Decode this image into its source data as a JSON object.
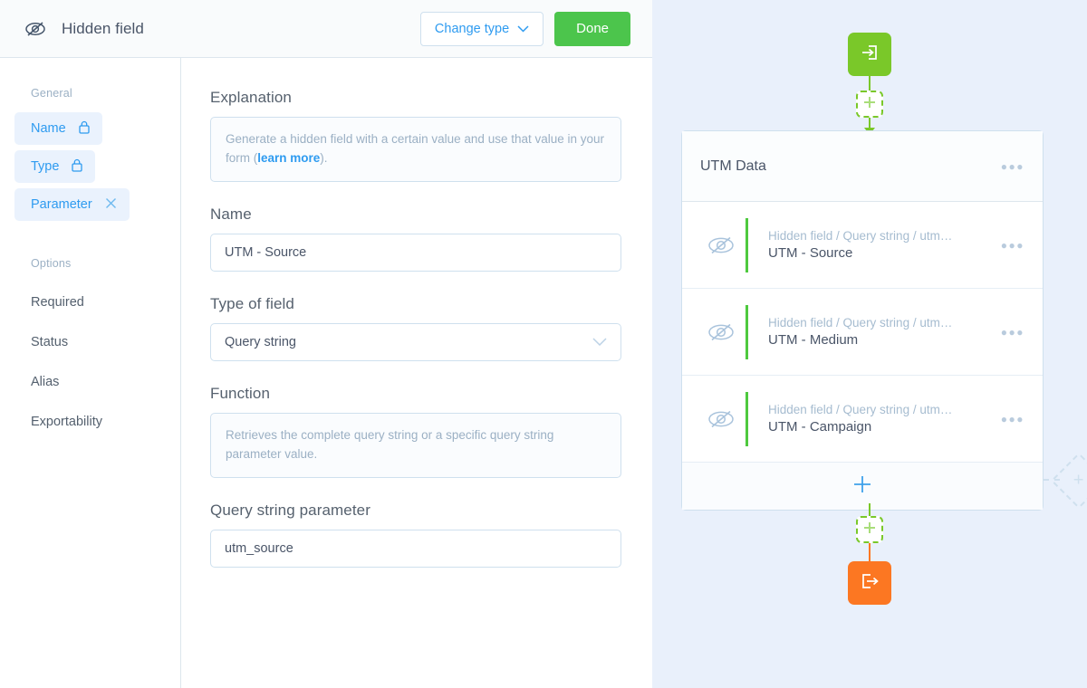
{
  "topbar": {
    "icon": "hidden-eye-icon",
    "title": "Hidden field",
    "change_type_label": "Change type",
    "change_type_icon": "chevron-down-icon",
    "done_label": "Done",
    "done_color": "#4cc54c",
    "link_color": "#2e9bf0"
  },
  "sidebar": {
    "general_label": "General",
    "options_label": "Options",
    "chips": [
      {
        "label": "Name",
        "icon": "lock-icon"
      },
      {
        "label": "Type",
        "icon": "lock-icon"
      },
      {
        "label": "Parameter",
        "icon": "close-icon"
      }
    ],
    "options": [
      {
        "label": "Required"
      },
      {
        "label": "Status"
      },
      {
        "label": "Alias"
      },
      {
        "label": "Exportability"
      }
    ]
  },
  "form": {
    "explanation_label": "Explanation",
    "explanation_text_before": "Generate a hidden field with a certain value and use that value in your form (",
    "explanation_link": "learn more",
    "explanation_text_after": ").",
    "name_label": "Name",
    "name_value": "UTM - Source",
    "type_label": "Type of field",
    "type_value": "Query string",
    "type_icon": "chevron-down-icon",
    "function_label": "Function",
    "function_text": "Retrieves the complete query string or a specific query string parameter value.",
    "parameter_label": "Query string parameter",
    "parameter_value": "utm_source"
  },
  "flow": {
    "background": "#e9f0fb",
    "start_node": {
      "icon": "enter-arrow-icon",
      "color": "#7ac829"
    },
    "end_node": {
      "icon": "exit-arrow-icon",
      "color": "#fc7722"
    },
    "add_step_top": {
      "icon": "plus-icon"
    },
    "add_step_bottom": {
      "icon": "plus-icon"
    },
    "add_branch": {
      "icon": "plus-icon"
    },
    "card": {
      "title": "UTM Data",
      "menu_icon": "more-options-icon",
      "accent_color": "#4ec93e",
      "rows": [
        {
          "icon": "hidden-eye-icon",
          "subtitle": "Hidden field / Query string / utm…",
          "name": "UTM - Source",
          "menu_icon": "more-options-icon"
        },
        {
          "icon": "hidden-eye-icon",
          "subtitle": "Hidden field / Query string / utm…",
          "name": "UTM - Medium",
          "menu_icon": "more-options-icon"
        },
        {
          "icon": "hidden-eye-icon",
          "subtitle": "Hidden field / Query string / utm…",
          "name": "UTM - Campaign",
          "menu_icon": "more-options-icon"
        }
      ],
      "add_field_icon": "plus-icon"
    }
  }
}
